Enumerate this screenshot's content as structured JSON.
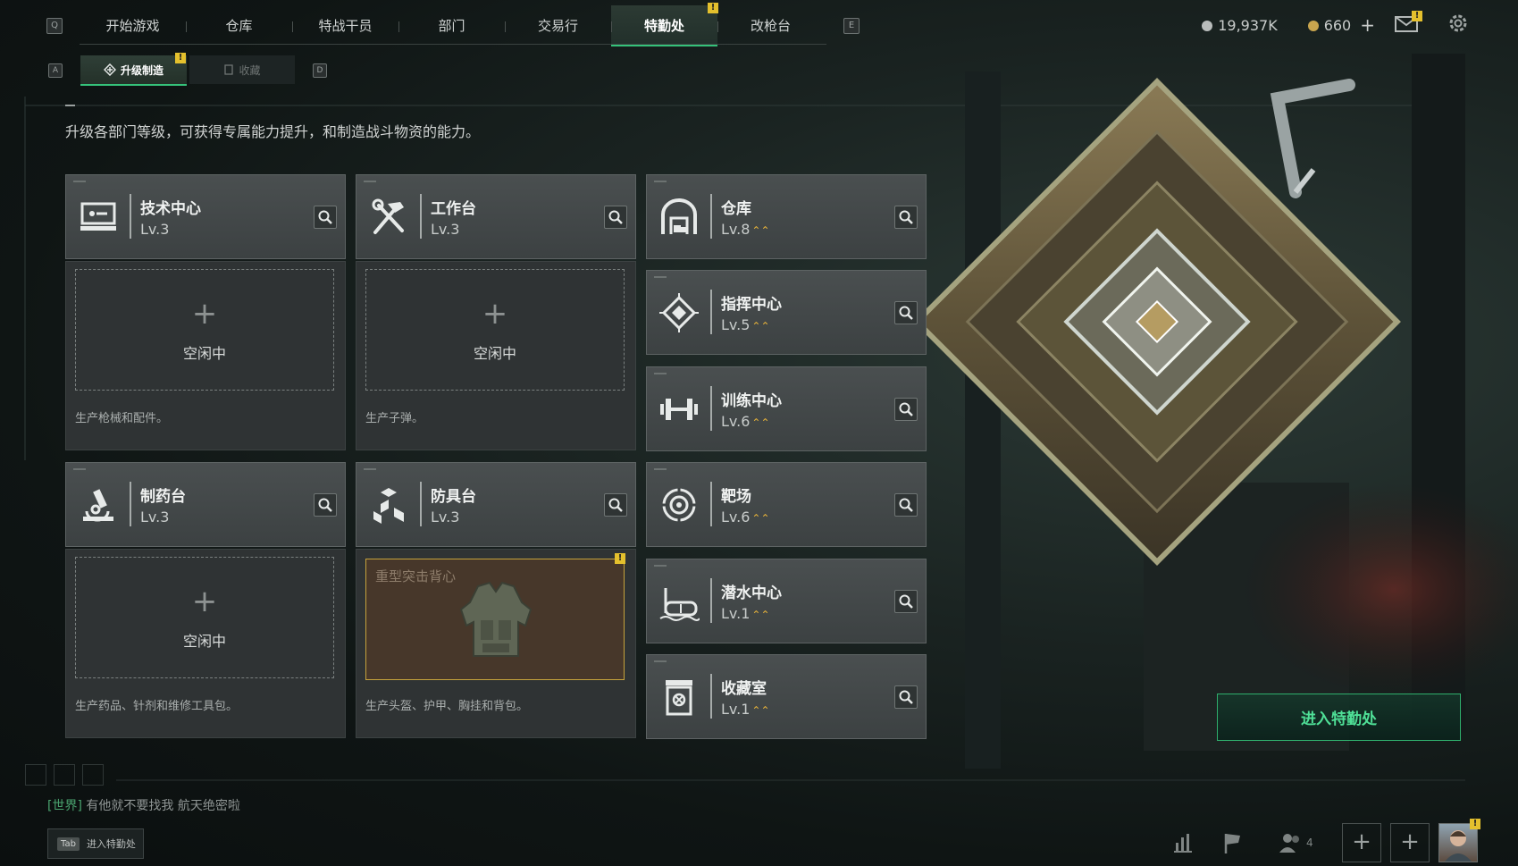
{
  "nav": {
    "key_left": "Q",
    "key_right": "E",
    "tabs": [
      {
        "label": "开始游戏",
        "active": false
      },
      {
        "label": "仓库",
        "active": false
      },
      {
        "label": "特战干员",
        "active": false
      },
      {
        "label": "部门",
        "active": false
      },
      {
        "label": "交易行",
        "active": false
      },
      {
        "label": "特勤处",
        "active": true
      },
      {
        "label": "改枪台",
        "active": false
      }
    ],
    "alert": "!"
  },
  "currency": {
    "silver": "19,937K",
    "gold": "660",
    "add": "+"
  },
  "mail_alert": "!",
  "subtabs": {
    "key_left": "A",
    "key_right": "D",
    "items": [
      {
        "label": "升级制造",
        "active": true
      },
      {
        "label": "收藏",
        "active": false
      }
    ],
    "alert": "!"
  },
  "description": "升级各部门等级，可获得专属能力提升，和制造战斗物资的能力。",
  "production_stations": [
    {
      "name": "技术中心",
      "level": "Lv.3",
      "icon": "computer-icon",
      "slot_state": "空闲中",
      "slot_plus": "+",
      "desc": "生产枪械和配件。"
    },
    {
      "name": "工作台",
      "level": "Lv.3",
      "icon": "hammer-wrench-icon",
      "slot_state": "空闲中",
      "slot_plus": "+",
      "desc": "生产子弹。"
    },
    {
      "name": "制药台",
      "level": "Lv.3",
      "icon": "microscope-icon",
      "slot_state": "空闲中",
      "slot_plus": "+",
      "desc": "生产药品、针剂和维修工具包。"
    },
    {
      "name": "防具台",
      "level": "Lv.3",
      "icon": "armor-blocks-icon",
      "slot_item": "重型突击背心",
      "desc": "生产头盔、护甲、胸挂和背包。"
    }
  ],
  "facilities": [
    {
      "name": "仓库",
      "level": "Lv.8",
      "icon": "warehouse-icon",
      "upgrade": "⌃⌃"
    },
    {
      "name": "指挥中心",
      "level": "Lv.5",
      "icon": "command-diamond-icon",
      "upgrade": "⌃⌃"
    },
    {
      "name": "训练中心",
      "level": "Lv.6",
      "icon": "dumbbell-icon",
      "upgrade": "⌃⌃"
    },
    {
      "name": "靶场",
      "level": "Lv.6",
      "icon": "target-icon",
      "upgrade": "⌃⌃"
    },
    {
      "name": "潜水中心",
      "level": "Lv.1",
      "icon": "diving-mask-icon",
      "upgrade": "⌃⌃"
    },
    {
      "name": "收藏室",
      "level": "Lv.1",
      "icon": "collection-case-icon",
      "upgrade": "⌃⌃"
    }
  ],
  "enter_button": "进入特勤处",
  "chat": {
    "channel": "[世界]",
    "message": "有他就不要找我  航天绝密啦"
  },
  "tab_hint": {
    "key": "Tab",
    "label": "进入特勤处"
  },
  "squad_count": "4",
  "colors": {
    "accent": "#35c27a",
    "alert": "#e4c02d",
    "upgrade": "#e7b33a"
  }
}
